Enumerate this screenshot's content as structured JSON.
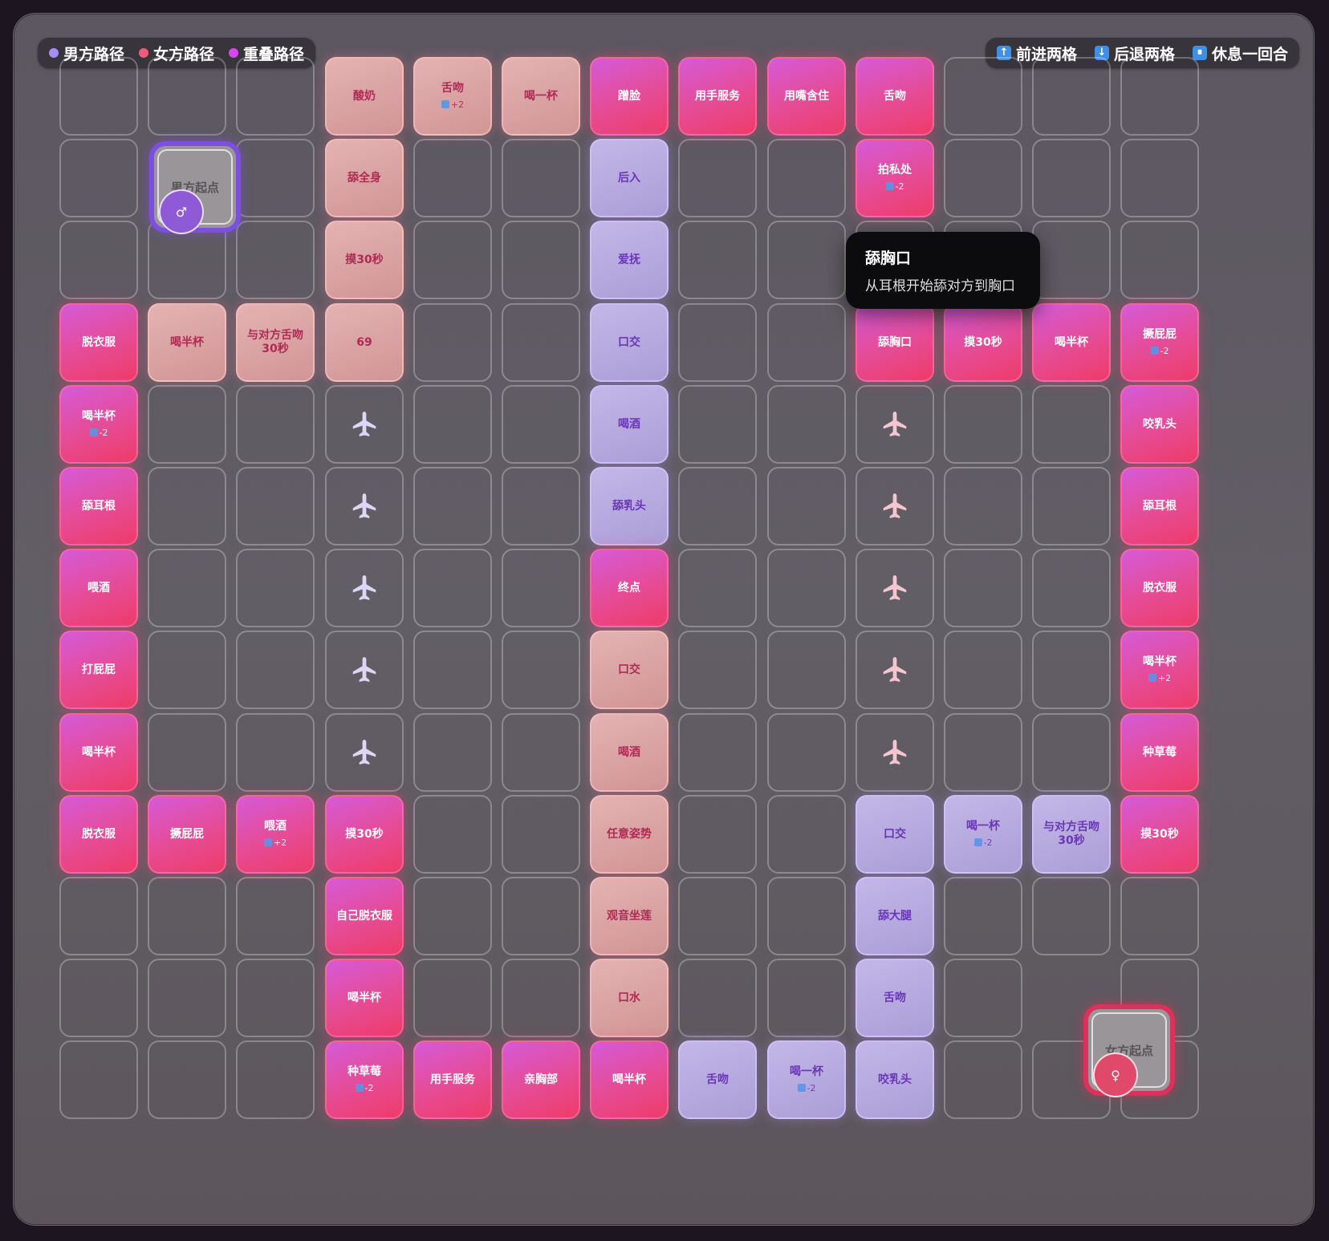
{
  "legend_left": [
    {
      "label": "男方路径",
      "color": "#a78bfa"
    },
    {
      "label": "女方路径",
      "color": "#f05a78"
    },
    {
      "label": "重叠路径",
      "color": "#d946ef"
    }
  ],
  "legend_right": [
    {
      "icon": "arrow-up-icon",
      "glyph": "↑",
      "label": "前进两格"
    },
    {
      "icon": "arrow-down-icon",
      "glyph": "↓",
      "label": "后退两格"
    },
    {
      "icon": "pause-icon",
      "glyph": "⏸",
      "label": "休息一回合"
    }
  ],
  "start_male": {
    "label": "男方起点",
    "token": "♂"
  },
  "start_female": {
    "label": "女方起点",
    "token": "♀"
  },
  "tooltip": {
    "title": "舔胸口",
    "desc": "从耳根开始舔对方到胸口"
  },
  "grid": {
    "cols": 13,
    "rows": 13
  },
  "cells": [
    {
      "r": 0,
      "c": 3,
      "t": "pink",
      "label": "酸奶"
    },
    {
      "r": 0,
      "c": 4,
      "t": "pink",
      "label": "舌吻",
      "sub": "+2"
    },
    {
      "r": 0,
      "c": 5,
      "t": "pink",
      "label": "喝一杯"
    },
    {
      "r": 0,
      "c": 6,
      "t": "mag",
      "label": "蹭脸"
    },
    {
      "r": 0,
      "c": 7,
      "t": "mag",
      "label": "用手服务"
    },
    {
      "r": 0,
      "c": 8,
      "t": "mag",
      "label": "用嘴含住"
    },
    {
      "r": 0,
      "c": 9,
      "t": "mag",
      "label": "舌吻"
    },
    {
      "r": 1,
      "c": 3,
      "t": "pink",
      "label": "舔全身"
    },
    {
      "r": 1,
      "c": 6,
      "t": "purple",
      "label": "后入"
    },
    {
      "r": 1,
      "c": 9,
      "t": "mag",
      "label": "拍私处",
      "sub": "-2"
    },
    {
      "r": 2,
      "c": 3,
      "t": "pink",
      "label": "摸30秒"
    },
    {
      "r": 2,
      "c": 6,
      "t": "purple",
      "label": "爱抚"
    },
    {
      "r": 3,
      "c": 0,
      "t": "mag",
      "label": "脱衣服"
    },
    {
      "r": 3,
      "c": 1,
      "t": "pink",
      "label": "喝半杯"
    },
    {
      "r": 3,
      "c": 2,
      "t": "pink",
      "label": "与对方舌吻30秒"
    },
    {
      "r": 3,
      "c": 3,
      "t": "pink",
      "label": "69"
    },
    {
      "r": 3,
      "c": 6,
      "t": "purple",
      "label": "口交"
    },
    {
      "r": 3,
      "c": 9,
      "t": "mag",
      "label": "舔胸口"
    },
    {
      "r": 3,
      "c": 10,
      "t": "mag",
      "label": "摸30秒"
    },
    {
      "r": 3,
      "c": 11,
      "t": "mag",
      "label": "喝半杯"
    },
    {
      "r": 3,
      "c": 12,
      "t": "mag",
      "label": "撅屁屁",
      "sub": "-2"
    },
    {
      "r": 4,
      "c": 0,
      "t": "mag",
      "label": "喝半杯",
      "sub": "-2"
    },
    {
      "r": 4,
      "c": 3,
      "t": "plane",
      "color": "#ddd6f5"
    },
    {
      "r": 4,
      "c": 6,
      "t": "purple",
      "label": "喝酒"
    },
    {
      "r": 4,
      "c": 9,
      "t": "plane",
      "color": "#f6c6d0"
    },
    {
      "r": 4,
      "c": 12,
      "t": "mag",
      "label": "咬乳头"
    },
    {
      "r": 5,
      "c": 0,
      "t": "mag",
      "label": "舔耳根"
    },
    {
      "r": 5,
      "c": 3,
      "t": "plane",
      "color": "#ddd6f5"
    },
    {
      "r": 5,
      "c": 6,
      "t": "purple",
      "label": "舔乳头"
    },
    {
      "r": 5,
      "c": 9,
      "t": "plane",
      "color": "#f6c6d0"
    },
    {
      "r": 5,
      "c": 12,
      "t": "mag",
      "label": "舔耳根"
    },
    {
      "r": 6,
      "c": 0,
      "t": "mag",
      "label": "喂酒"
    },
    {
      "r": 6,
      "c": 3,
      "t": "plane",
      "color": "#ddd6f5"
    },
    {
      "r": 6,
      "c": 6,
      "t": "mag",
      "label": "终点"
    },
    {
      "r": 6,
      "c": 9,
      "t": "plane",
      "color": "#f6c6d0"
    },
    {
      "r": 6,
      "c": 12,
      "t": "mag",
      "label": "脱衣服"
    },
    {
      "r": 7,
      "c": 0,
      "t": "mag",
      "label": "打屁屁"
    },
    {
      "r": 7,
      "c": 3,
      "t": "plane",
      "color": "#ddd6f5"
    },
    {
      "r": 7,
      "c": 6,
      "t": "pink",
      "label": "口交"
    },
    {
      "r": 7,
      "c": 9,
      "t": "plane",
      "color": "#f6c6d0"
    },
    {
      "r": 7,
      "c": 12,
      "t": "mag",
      "label": "喝半杯",
      "sub": "+2"
    },
    {
      "r": 8,
      "c": 0,
      "t": "mag",
      "label": "喝半杯"
    },
    {
      "r": 8,
      "c": 3,
      "t": "plane",
      "color": "#ddd6f5"
    },
    {
      "r": 8,
      "c": 6,
      "t": "pink",
      "label": "喝酒"
    },
    {
      "r": 8,
      "c": 9,
      "t": "plane",
      "color": "#f6c6d0"
    },
    {
      "r": 8,
      "c": 12,
      "t": "mag",
      "label": "种草莓"
    },
    {
      "r": 9,
      "c": 0,
      "t": "mag",
      "label": "脱衣服"
    },
    {
      "r": 9,
      "c": 1,
      "t": "mag",
      "label": "撅屁屁"
    },
    {
      "r": 9,
      "c": 2,
      "t": "mag",
      "label": "喂酒",
      "sub": "+2"
    },
    {
      "r": 9,
      "c": 3,
      "t": "mag",
      "label": "摸30秒"
    },
    {
      "r": 9,
      "c": 6,
      "t": "pink",
      "label": "任意姿势"
    },
    {
      "r": 9,
      "c": 9,
      "t": "purple",
      "label": "口交"
    },
    {
      "r": 9,
      "c": 10,
      "t": "purple",
      "label": "喝一杯",
      "sub": "-2"
    },
    {
      "r": 9,
      "c": 11,
      "t": "purple",
      "label": "与对方舌吻30秒"
    },
    {
      "r": 9,
      "c": 12,
      "t": "mag",
      "label": "摸30秒"
    },
    {
      "r": 10,
      "c": 3,
      "t": "mag",
      "label": "自己脱衣服"
    },
    {
      "r": 10,
      "c": 6,
      "t": "pink",
      "label": "观音坐莲"
    },
    {
      "r": 10,
      "c": 9,
      "t": "purple",
      "label": "舔大腿"
    },
    {
      "r": 11,
      "c": 3,
      "t": "mag",
      "label": "喝半杯"
    },
    {
      "r": 11,
      "c": 6,
      "t": "pink",
      "label": "口水"
    },
    {
      "r": 11,
      "c": 9,
      "t": "purple",
      "label": "舌吻"
    },
    {
      "r": 12,
      "c": 3,
      "t": "mag",
      "label": "种草莓",
      "sub": "-2"
    },
    {
      "r": 12,
      "c": 4,
      "t": "mag",
      "label": "用手服务"
    },
    {
      "r": 12,
      "c": 5,
      "t": "mag",
      "label": "亲胸部"
    },
    {
      "r": 12,
      "c": 6,
      "t": "mag",
      "label": "喝半杯"
    },
    {
      "r": 12,
      "c": 7,
      "t": "purple",
      "label": "舌吻"
    },
    {
      "r": 12,
      "c": 8,
      "t": "purple",
      "label": "喝一杯",
      "sub": "-2"
    },
    {
      "r": 12,
      "c": 9,
      "t": "purple",
      "label": "咬乳头"
    }
  ]
}
